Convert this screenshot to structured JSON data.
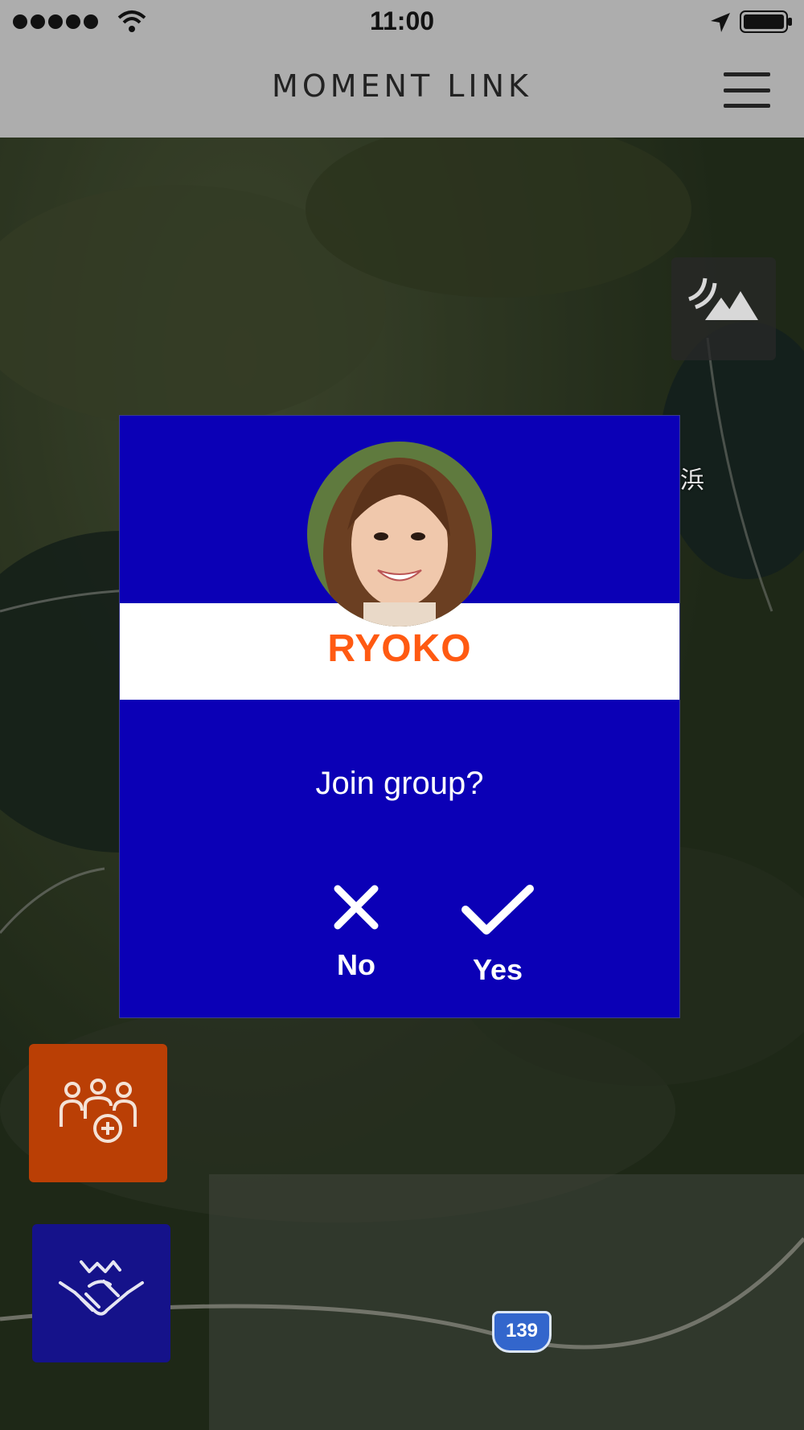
{
  "status_bar": {
    "time": "11:00"
  },
  "header": {
    "app_title": "MOMENT LINK"
  },
  "map": {
    "place_label": "浜",
    "road_number": "139"
  },
  "dialog": {
    "name": "RYOKO",
    "question": "Join group?",
    "no_label": "No",
    "yes_label": "Yes"
  },
  "colors": {
    "dialog_bg": "#0b00b6",
    "name_color": "#ff5a12",
    "group_button": "#ba3f05",
    "handshake_button": "#15128a",
    "header_bg": "#adadad"
  },
  "icons": {
    "terrain_toggle": "terrain-icon",
    "group_add": "group-add-icon",
    "handshake": "handshake-icon",
    "menu": "menu-icon",
    "no": "close-icon",
    "yes": "check-icon"
  }
}
